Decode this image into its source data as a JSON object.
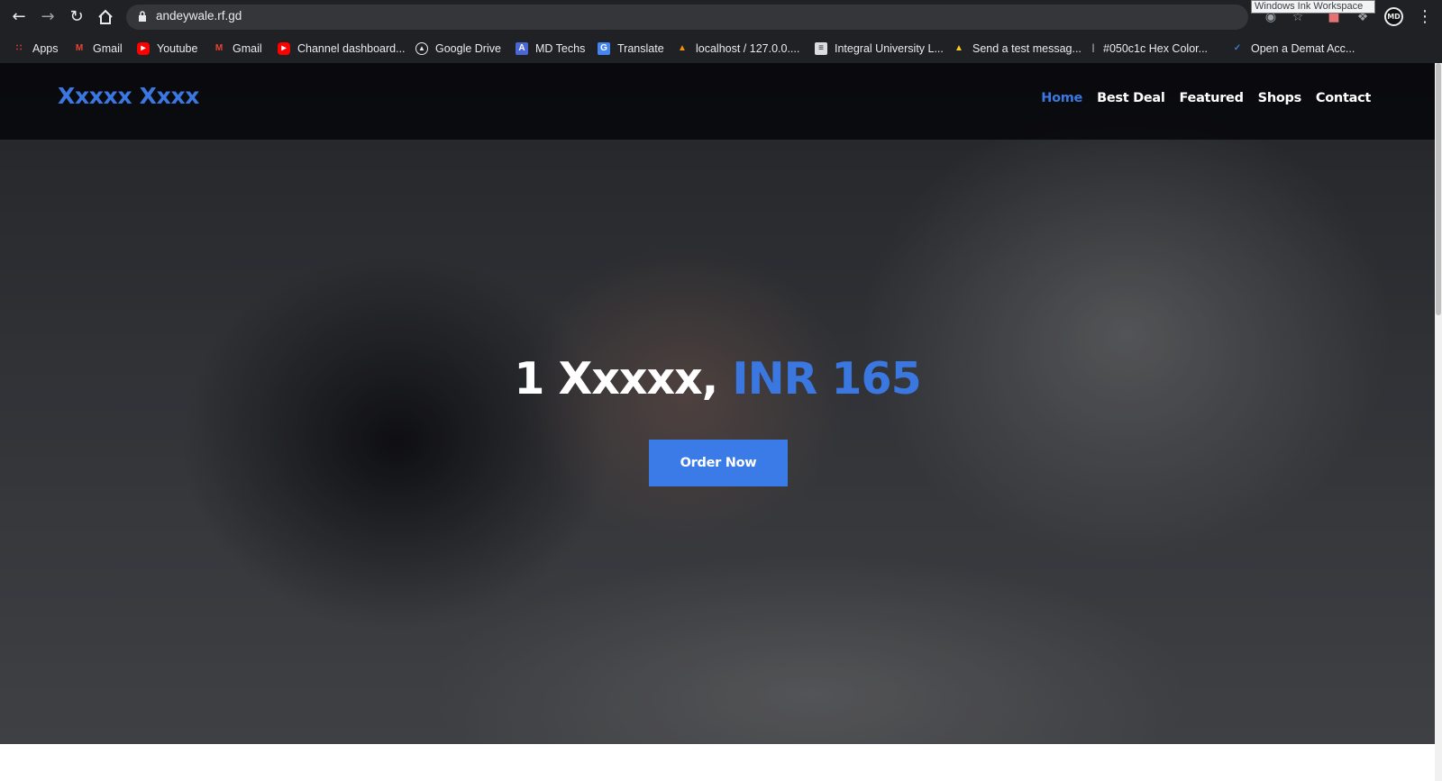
{
  "browser": {
    "url": "andeywale.rf.gd",
    "tooltip": "Windows Ink Workspace",
    "profile_initials": "MD",
    "icons": [
      "back-icon",
      "forward-icon",
      "reload-icon",
      "home-icon",
      "lock-icon",
      "star-icon",
      "extensions-icon",
      "menu-icon"
    ]
  },
  "bookmarks": [
    {
      "label": "Apps",
      "icon": "apps-grid-icon",
      "color": "#ea4335"
    },
    {
      "label": "Gmail",
      "icon": "gmail-icon",
      "color": "#ea4335"
    },
    {
      "label": "Youtube",
      "icon": "youtube-icon",
      "color": "#ff0000"
    },
    {
      "label": "Gmail",
      "icon": "gmail-icon",
      "color": "#ea4335"
    },
    {
      "label": "Channel dashboard...",
      "icon": "youtube-icon",
      "color": "#ff0000"
    },
    {
      "label": "Google Drive",
      "icon": "drive-icon",
      "color": "#e8eaed"
    },
    {
      "label": "MD Techs",
      "icon": "md-techs-icon",
      "color": "#4a67d6"
    },
    {
      "label": "Translate",
      "icon": "translate-icon",
      "color": "#4285f4"
    },
    {
      "label": "localhost / 127.0.0....",
      "icon": "phpmyadmin-icon",
      "color": "#f29111"
    },
    {
      "label": "Integral University L...",
      "icon": "page-icon",
      "color": "#e8eaed"
    },
    {
      "label": "Send a test messag...",
      "icon": "firebase-icon",
      "color": "#ffca28"
    },
    {
      "label": "#050c1c Hex Color...",
      "icon": "color-icon",
      "color": "#9aa0a6"
    },
    {
      "label": "Open a Demat Acc...",
      "icon": "demat-icon",
      "color": "#387ed1"
    }
  ],
  "site": {
    "logo": "Xxxxx Xxxx",
    "nav": [
      "Home",
      "Best Deal",
      "Featured",
      "Shops",
      "Contact"
    ],
    "active_nav": "Home",
    "headline_main": "1 Xxxxx,",
    "headline_price": "INR 165",
    "cta": "Order Now"
  },
  "colors": {
    "accent": "#3a77e0",
    "button": "#3a7be8",
    "header_bg": "#050508"
  }
}
